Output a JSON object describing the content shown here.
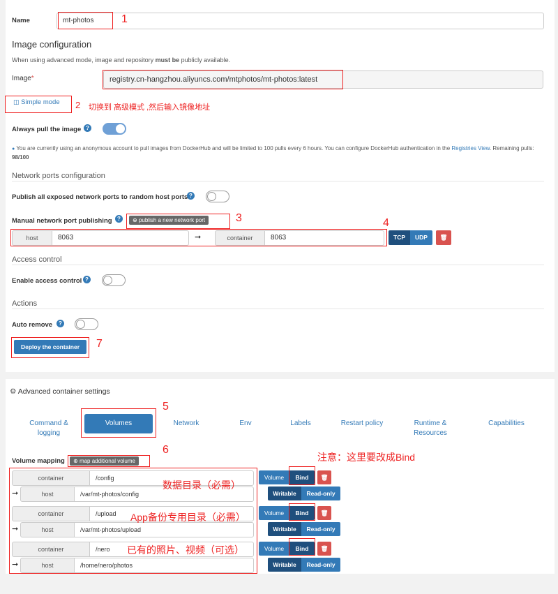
{
  "form": {
    "name_label": "Name",
    "name_value": "mt-photos",
    "image_config_title": "Image configuration",
    "image_config_note_pre": "When using advanced mode, image and repository ",
    "image_config_note_bold": "must be",
    "image_config_note_post": " publicly available.",
    "image_label": "Image",
    "image_required": "*",
    "image_value": "registry.cn-hangzhou.aliyuncs.com/mtphotos/mt-photos:latest",
    "simple_mode": "Simple mode",
    "always_pull_label": "Always pull the image",
    "always_pull_on": true,
    "dockerhub_note": "You are currently using an anonymous account to pull images from DockerHub and will be limited to 100 pulls every 6 hours. You can configure DockerHub authentication in the",
    "registries_view": "Registries View",
    "remaining_pulls_label": ". Remaining pulls: ",
    "remaining_pulls_value": "98/100"
  },
  "ports": {
    "section_title": "Network ports configuration",
    "publish_all_label": "Publish all exposed network ports to random host ports",
    "manual_label": "Manual network port publishing",
    "publish_button": "publish a new network port",
    "host_addon": "host",
    "host_value": "8063",
    "container_addon": "container",
    "container_value": "8063",
    "tcp": "TCP",
    "udp": "UDP"
  },
  "access": {
    "section_title": "Access control",
    "enable_label": "Enable access control"
  },
  "actions": {
    "section_title": "Actions",
    "auto_remove_label": "Auto remove",
    "deploy_button": "Deploy the container"
  },
  "advanced": {
    "title": "Advanced container settings",
    "tabs": [
      "Command & logging",
      "Volumes",
      "Network",
      "Env",
      "Labels",
      "Restart policy",
      "Runtime & Resources",
      "Capabilities"
    ],
    "volume_mapping_label": "Volume mapping",
    "map_button": "map additional volume",
    "volume_btn": "Volume",
    "bind_btn": "Bind",
    "writable_btn": "Writable",
    "readonly_btn": "Read-only",
    "container_addon": "container",
    "host_addon": "host",
    "volumes": [
      {
        "container": "/config",
        "host": "/var/mt-photos/config"
      },
      {
        "container": "/upload",
        "host": "/var/mt-photos/upload"
      },
      {
        "container": "/nero",
        "host": "/home/nero/photos"
      }
    ]
  },
  "annotations": {
    "n1": "1",
    "n2": "2",
    "n2_text": "切换到 高级模式 ,然后输入镜像地址",
    "n3": "3",
    "n4": "4",
    "n5": "5",
    "n6": "6",
    "n7": "7",
    "bind_note": "注意：这里要改成Bind",
    "vol1_note": "数据目录（必需）",
    "vol2_note": "App备份专用目录（必需）",
    "vol3_note": "已有的照片、视频（可选）"
  }
}
